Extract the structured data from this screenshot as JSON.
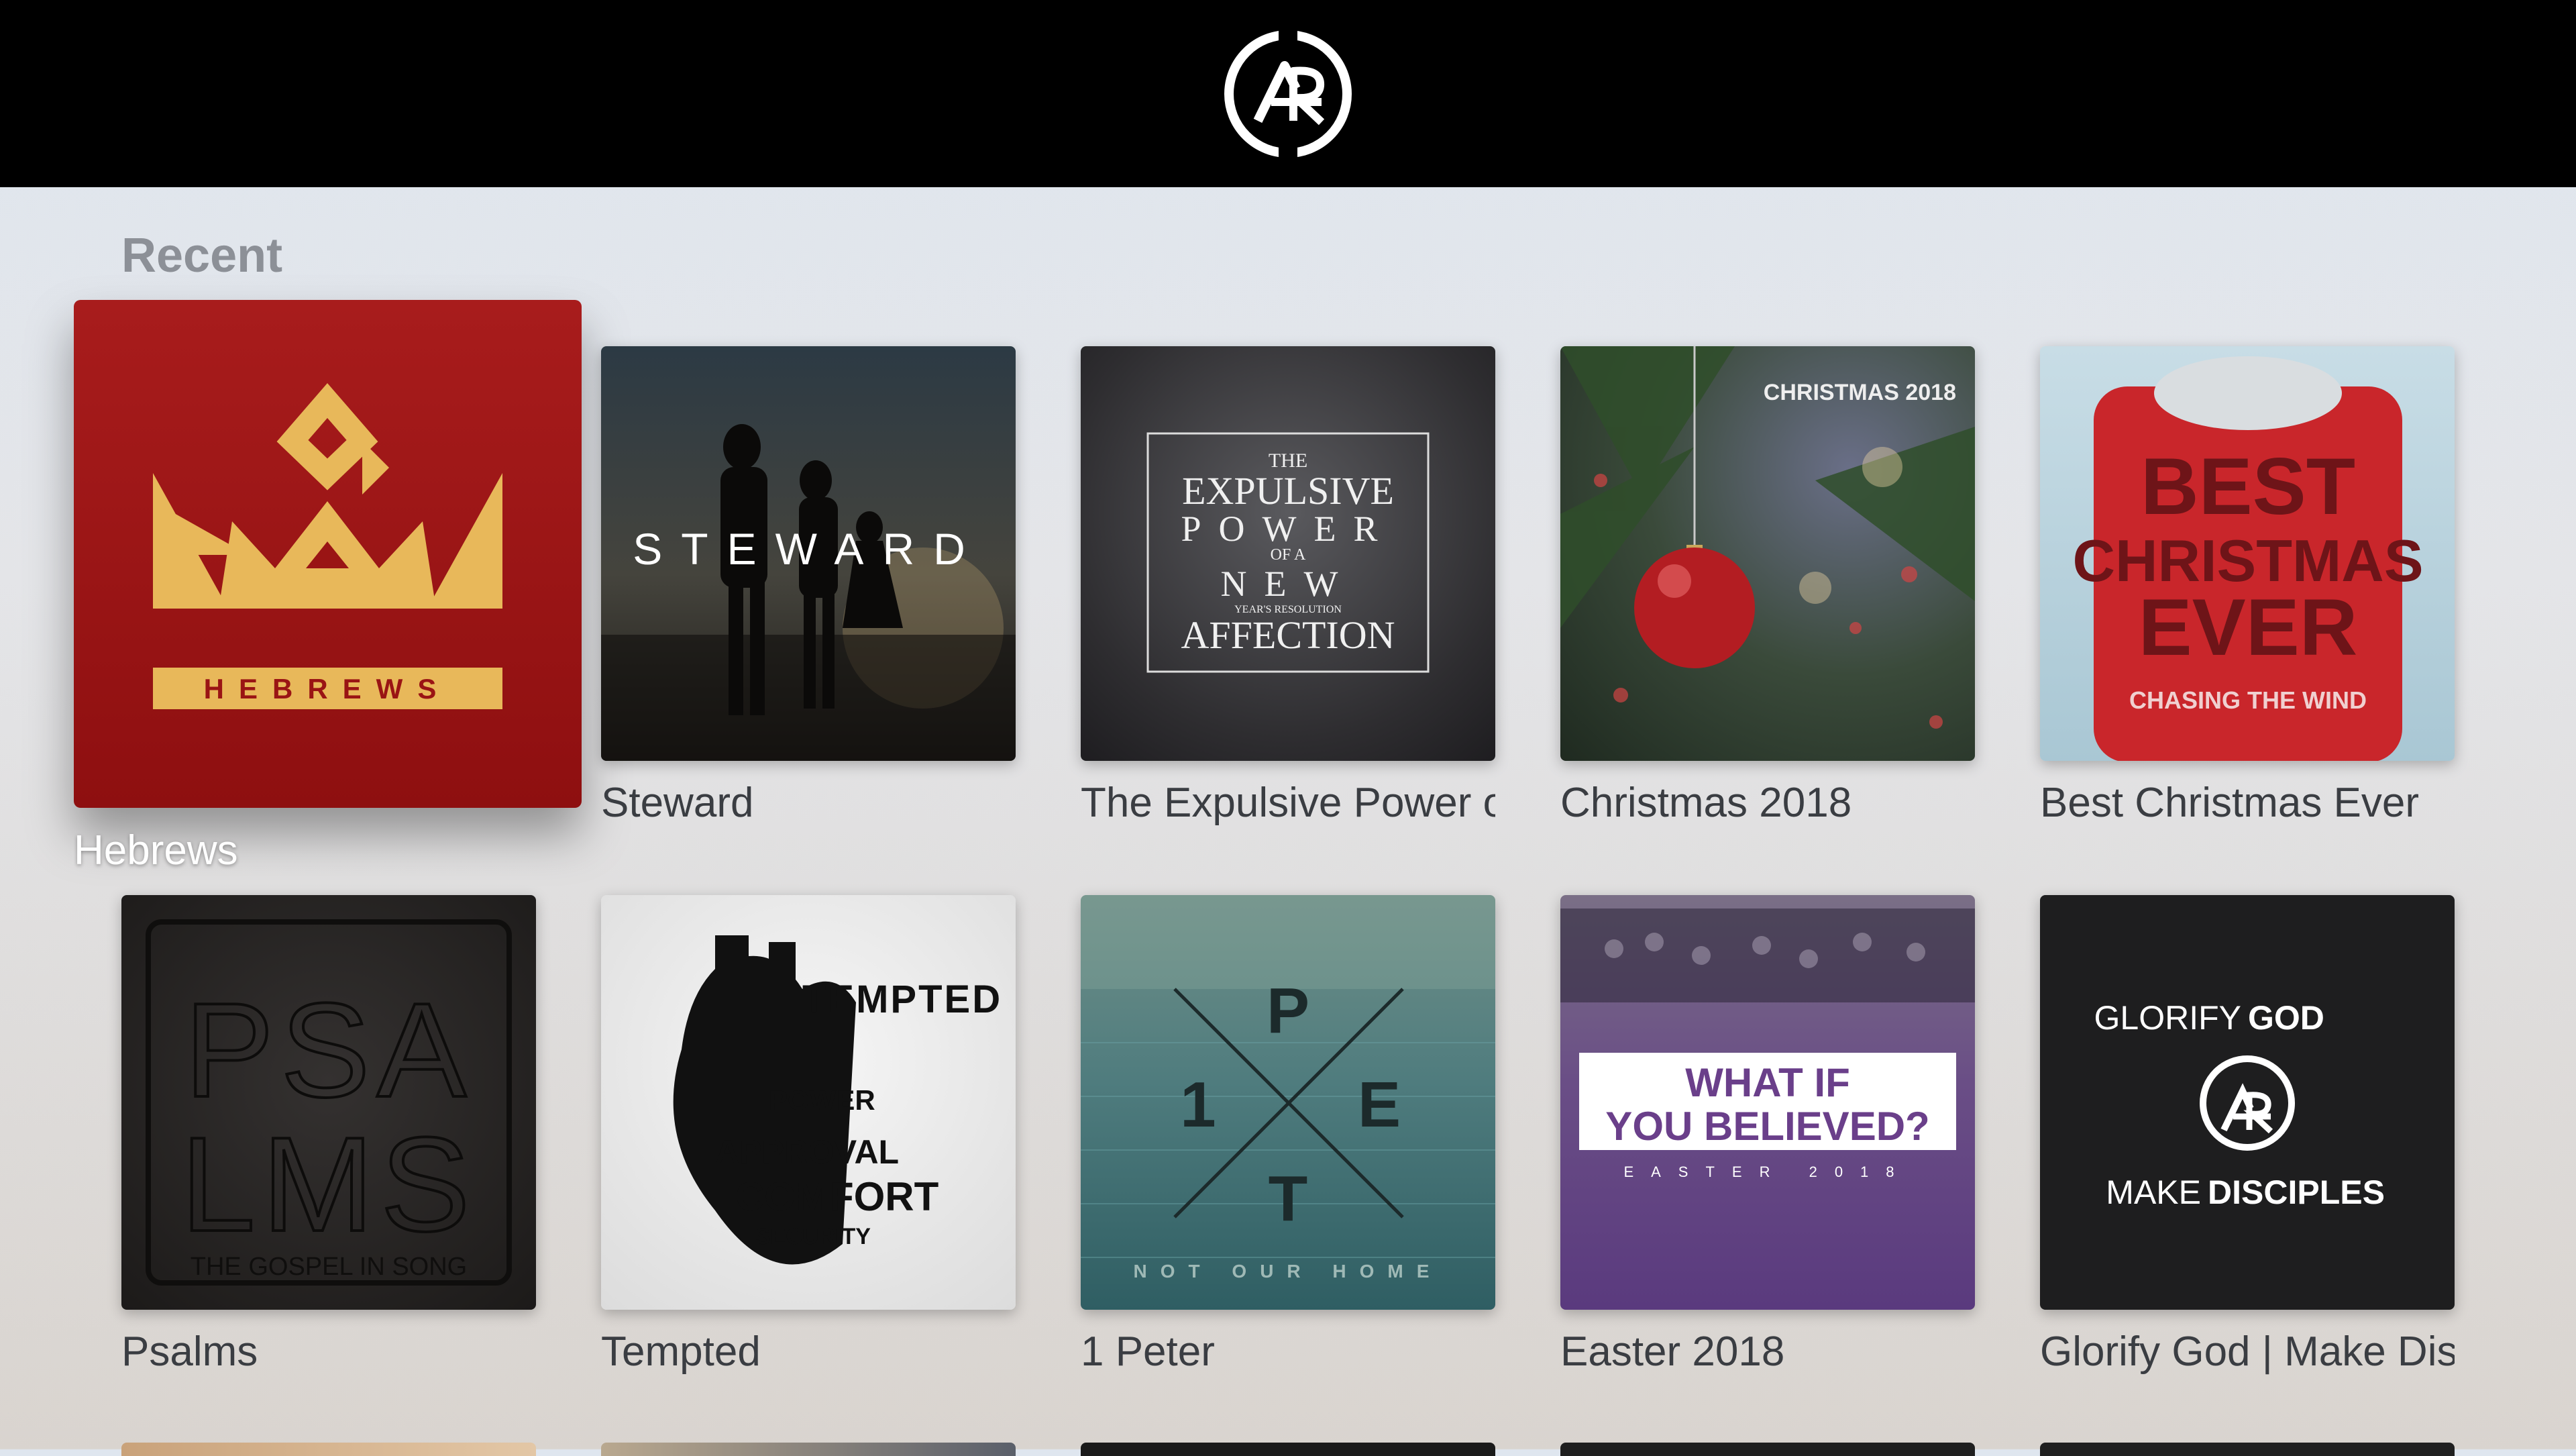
{
  "header": {
    "logo_icon": "church-ar-logo"
  },
  "section": {
    "title": "Recent"
  },
  "row1": [
    {
      "caption": "Hebrews",
      "art_text": "HEBREWS"
    },
    {
      "caption": "Steward",
      "art_text": "STEWARD"
    },
    {
      "caption": "The Expulsive Power of a New Year's Resolution Affection",
      "art_text_lines": [
        "THE",
        "EXPULSIVE",
        "POWER",
        "OF A",
        "NEW",
        "YEAR'S RESOLUTION",
        "AFFECTION"
      ]
    },
    {
      "caption": "Christmas 2018",
      "art_text": "CHRISTMAS 2018"
    },
    {
      "caption": "Best Christmas Ever",
      "art_text_lines": [
        "BEST",
        "CHRISTMAS",
        "EVER",
        "CHASING THE WIND"
      ]
    }
  ],
  "row2": [
    {
      "caption": "Psalms",
      "art_text_lines": [
        "PSA",
        "LMS",
        "THE GOSPEL IN SONG"
      ]
    },
    {
      "caption": "Tempted",
      "art_text_lines": [
        "TEMPTED",
        "POWER",
        "APPROVAL",
        "COMFORT",
        "SECURITY"
      ]
    },
    {
      "caption": "1 Peter",
      "art_text_lines": [
        "P",
        "1",
        "E",
        "T",
        "NOT OUR HOME"
      ]
    },
    {
      "caption": "Easter 2018",
      "art_text_lines": [
        "WHAT IF",
        "YOU BELIEVED?",
        "EASTER 2018"
      ]
    },
    {
      "caption": "Glorify God | Make Disciples",
      "art_text_lines": [
        "GLORIFY",
        "GOD",
        "MAKE",
        "DISCIPLES"
      ]
    }
  ],
  "colors": {
    "topbar": "#000000",
    "hebrews_red": "#9e1515",
    "gold": "#e8b85a"
  }
}
